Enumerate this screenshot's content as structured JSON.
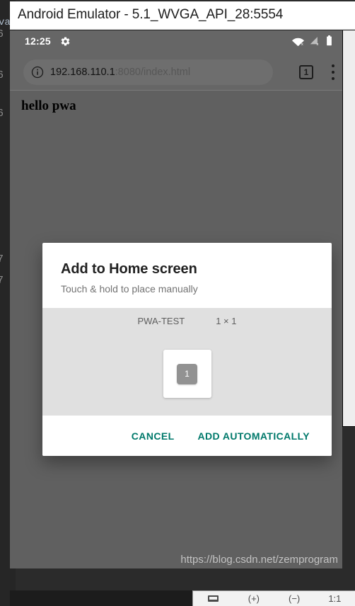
{
  "window": {
    "title": "Android Emulator - 5.1_WVGA_API_28:5554"
  },
  "backdrop": {
    "gutter_numbers": [
      "6",
      "6",
      "6",
      "7",
      "7"
    ],
    "code_fragment": "va"
  },
  "status_bar": {
    "time": "12:25",
    "gear_icon": "gear-icon",
    "wifi_icon": "wifi-no-connection-icon",
    "cellular_icon": "cellular-no-connection-icon",
    "battery_icon": "battery-icon"
  },
  "browser": {
    "security_icon": "info-circle-icon",
    "url_host": "192.168.110.1",
    "url_path": ":8080/index.html",
    "url_full": "192.168.110.1:8080/index.html",
    "tab_count": "1",
    "overflow_menu_icon": "more-vert-icon"
  },
  "page": {
    "heading": "hello pwa"
  },
  "dialog": {
    "title": "Add to Home screen",
    "subtitle": "Touch & hold to place manually",
    "widget_name": "PWA-TEST",
    "widget_size": "1 × 1",
    "widget_badge": "1",
    "cancel_label": "CANCEL",
    "confirm_label": "ADD AUTOMATICALLY",
    "accent_color": "#00796b"
  },
  "watermark": {
    "text": "https://blog.csdn.net/zemprogram"
  },
  "emulator_controls": {
    "screenshot_label": "",
    "zoom_in_label": "(+)",
    "zoom_out_label": "(−)",
    "actual_size_label": "1:1"
  }
}
